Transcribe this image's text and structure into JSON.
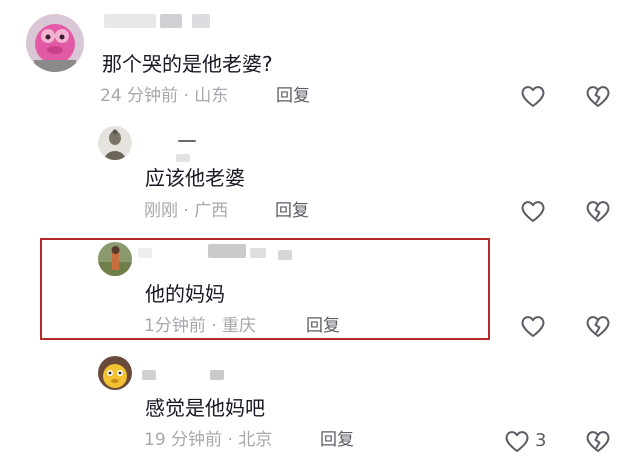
{
  "comments": [
    {
      "text": "那个哭的是他老婆?",
      "time": "24 分钟前",
      "location": "山东",
      "reply_label": "回复",
      "like_count": ""
    },
    {
      "text": "应该他老婆",
      "time": "刚刚",
      "location": "广西",
      "reply_label": "回复",
      "like_count": ""
    },
    {
      "text": "他的妈妈",
      "time": "1分钟前",
      "location": "重庆",
      "reply_label": "回复",
      "like_count": ""
    },
    {
      "text": "感觉是他妈吧",
      "time": "19 分钟前",
      "location": "北京",
      "reply_label": "回复",
      "like_count": "3"
    }
  ],
  "meta_separator": " · ",
  "colors": {
    "highlight_border": "#b42a2a",
    "primary_text": "#161823",
    "secondary_text": "#a6a8ad",
    "icon_stroke": "#5c5e66"
  }
}
